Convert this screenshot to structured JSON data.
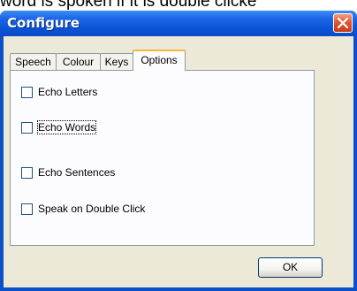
{
  "background_text": "word is spoken if it is double clicke",
  "window": {
    "title": "Configure"
  },
  "tabs": [
    {
      "label": "Speech",
      "active": false
    },
    {
      "label": "Colour",
      "active": false
    },
    {
      "label": "Keys",
      "active": false
    },
    {
      "label": "Options",
      "active": true
    }
  ],
  "options": [
    {
      "label": "Echo Letters",
      "checked": false
    },
    {
      "label": "Echo Words",
      "checked": false,
      "focused": true
    },
    {
      "label": "Echo Sentences",
      "checked": false
    },
    {
      "label": "Speak on Double Click",
      "checked": false
    }
  ],
  "buttons": {
    "ok": "OK"
  },
  "colors": {
    "titlebar": "#0a53d6",
    "close_button": "#e2562c",
    "dialog_face": "#ece9d8",
    "active_tab_highlight": "#f7b63c"
  }
}
